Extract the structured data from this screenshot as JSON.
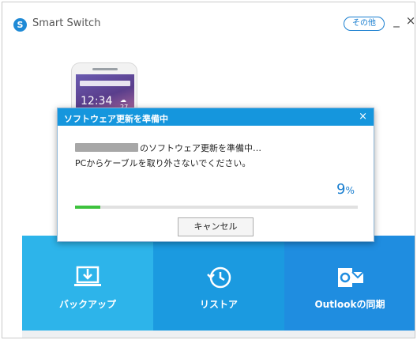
{
  "app": {
    "logo_letter": "S",
    "title": "Smart Switch",
    "more_label": "その他",
    "minimize_glyph": "_",
    "close_glyph": "×"
  },
  "phone": {
    "time": "12:34",
    "weather": "☁ 27"
  },
  "dialog": {
    "title": "ソフトウェア更新を準備中",
    "close_glyph": "×",
    "message_line1": "のソフトウェア更新を準備中…",
    "message_line2": "PCからケーブルを取り外さないでください。",
    "progress_percent": 9,
    "progress_number": "9",
    "progress_unit": "%",
    "cancel_label": "キャンセル"
  },
  "tiles": [
    {
      "label": "バックアップ",
      "icon": "backup-icon"
    },
    {
      "label": "リストア",
      "icon": "restore-icon"
    },
    {
      "label": "Outlookの同期",
      "icon": "outlook-icon"
    }
  ],
  "colors": {
    "accent": "#1596dd",
    "progress": "#3ec23e",
    "backup_tile": "#2db4ea",
    "restore_tile": "#1b9ae0",
    "outlook_tile": "#1f8de0"
  }
}
